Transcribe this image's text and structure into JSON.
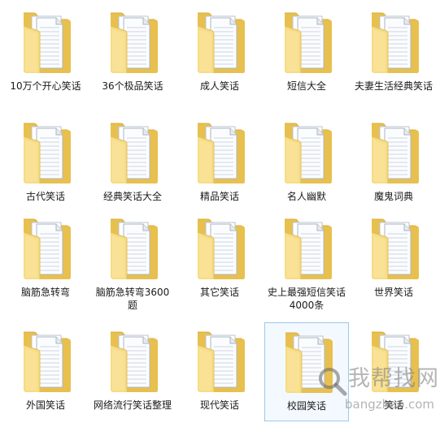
{
  "folders": [
    {
      "name": "10万个开心笑话",
      "selected": false
    },
    {
      "name": "36个极品笑话",
      "selected": false
    },
    {
      "name": "成人笑话",
      "selected": false
    },
    {
      "name": "短信大全",
      "selected": false
    },
    {
      "name": "夫妻生活经典笑话",
      "selected": false
    },
    {
      "name": "古代笑话",
      "selected": false
    },
    {
      "name": "经典笑话大全",
      "selected": false
    },
    {
      "name": "精品笑话",
      "selected": false
    },
    {
      "name": "名人幽默",
      "selected": false
    },
    {
      "name": "魔鬼词典",
      "selected": false
    },
    {
      "name": "脑筋急转弯",
      "selected": false
    },
    {
      "name": "脑筋急转弯3600题",
      "selected": false
    },
    {
      "name": "其它笑话",
      "selected": false
    },
    {
      "name": "史上最强短信笑话4000条",
      "selected": false
    },
    {
      "name": "世界笑话",
      "selected": false
    },
    {
      "name": "外国笑话",
      "selected": false
    },
    {
      "name": "网络流行笑话整理",
      "selected": false
    },
    {
      "name": "现代笑话",
      "selected": false
    },
    {
      "name": "校园笑话",
      "selected": true
    },
    {
      "name": "笑话",
      "selected": false
    }
  ],
  "icon": "folder-with-documents-icon",
  "watermark": {
    "icon": "magnifier-icon",
    "text": "我帮找网",
    "url": "bangzhao.com"
  },
  "colors": {
    "folder_back": "#e8c04e",
    "folder_front": "#f6dc83",
    "selection_border": "#99c9ef",
    "selection_fill": "#f4f9ff"
  }
}
